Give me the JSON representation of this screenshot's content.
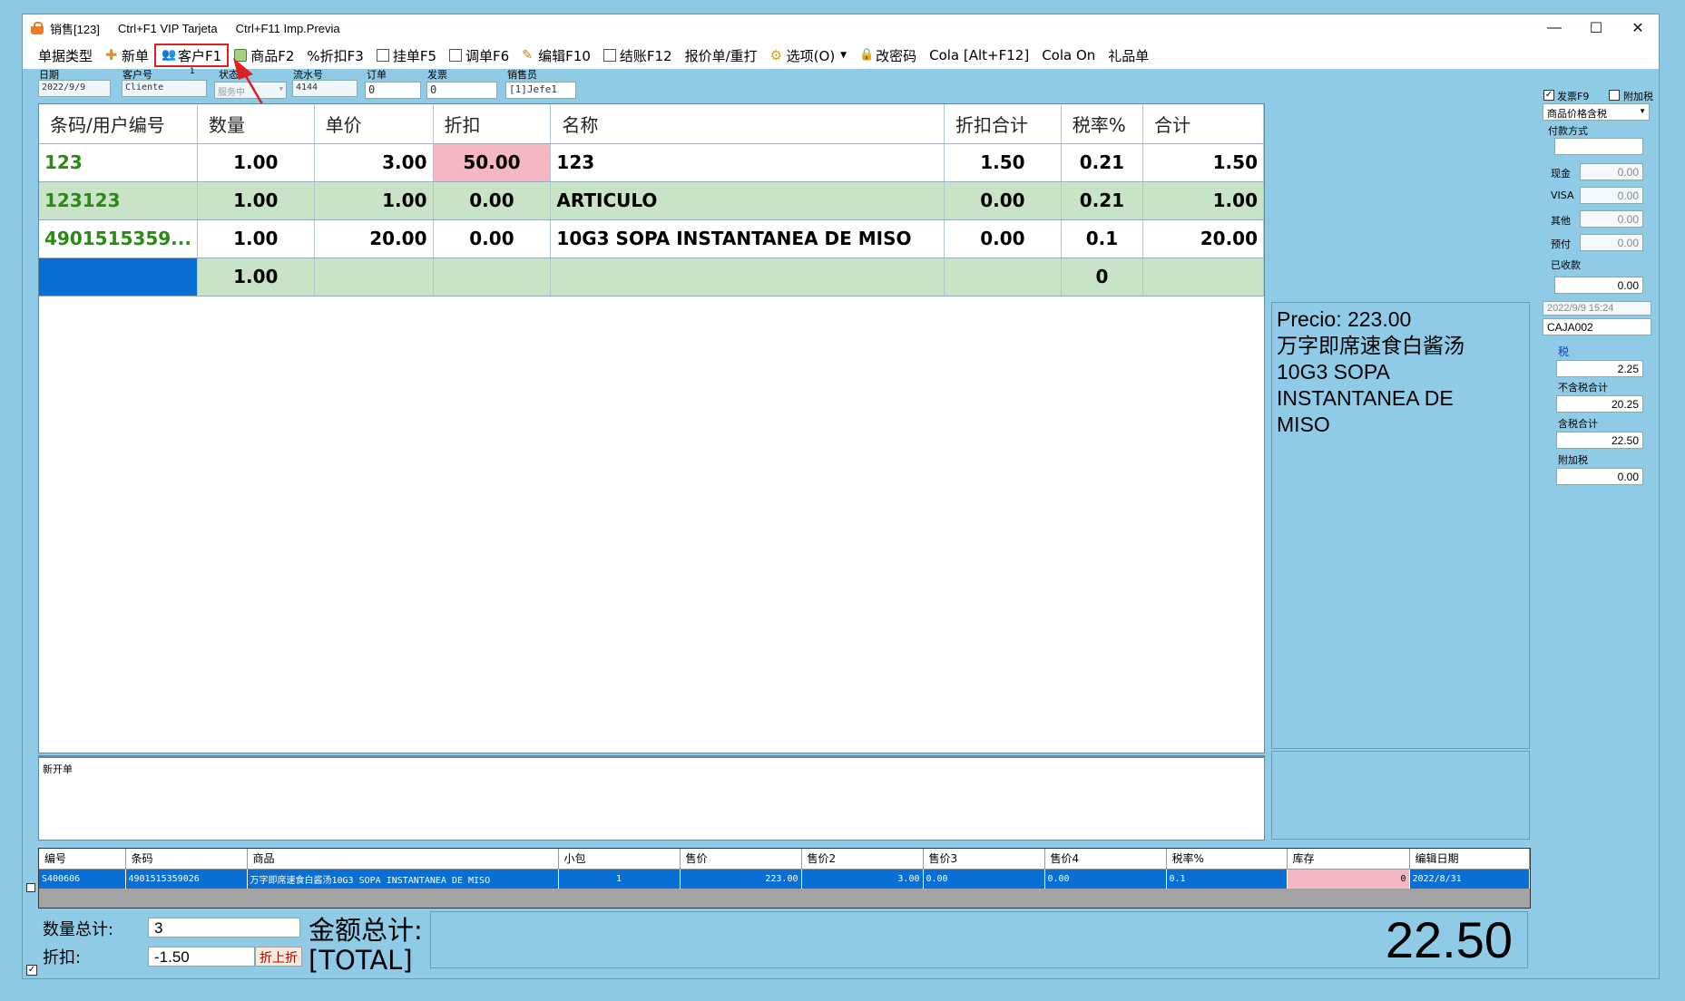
{
  "titlebar": {
    "title": "销售[123]",
    "hint1": "Ctrl+F1 VIP Tarjeta",
    "hint2": "Ctrl+F11 Imp.Previa",
    "min": "—",
    "max": "☐",
    "close": "✕"
  },
  "menu": {
    "doc_type": "单据类型",
    "new": "新单",
    "customer": "客户F1",
    "product": "商品F2",
    "discount": "%折扣F3",
    "hold": "挂单F5",
    "recall": "调单F6",
    "edit": "编辑F10",
    "checkout": "结账F12",
    "quote": "报价单/重打",
    "options": "选项(O)",
    "password": "改密码",
    "cola": "Cola [Alt+F12]",
    "cola_on": "Cola On",
    "gift": "礼品单"
  },
  "header": {
    "date_label": "日期",
    "date_value": "2022/9/9",
    "cust_label": "客户号",
    "cust_value": "Cliente",
    "cust_flag": "1",
    "status_label": "状态",
    "status_value": "服务中",
    "serial_label": "流水号",
    "serial_value": "4144",
    "order_label": "订单",
    "order_value": "0",
    "invoice_label": "发票",
    "invoice_value": "0",
    "seller_label": "销售员",
    "seller_value": "[1]Jefe1"
  },
  "grid": {
    "columns": [
      "条码/用户编号",
      "数量",
      "单价",
      "折扣",
      "名称",
      "折扣合计",
      "税率%",
      "合计"
    ],
    "rows": [
      {
        "code": "123",
        "qty": "1.00",
        "price": "3.00",
        "disc": "50.00",
        "name": "123",
        "disc_total": "1.50",
        "tax": "0.21",
        "total": "1.50"
      },
      {
        "code": "123123",
        "qty": "1.00",
        "price": "1.00",
        "disc": "0.00",
        "name": "ARTICULO",
        "disc_total": "0.00",
        "tax": "0.21",
        "total": "1.00"
      },
      {
        "code": "4901515359...",
        "qty": "1.00",
        "price": "20.00",
        "disc": "0.00",
        "name": "10G3 SOPA INSTANTANEA DE MISO",
        "disc_total": "0.00",
        "tax": "0.1",
        "total": "20.00"
      },
      {
        "code": "",
        "qty": "1.00",
        "price": "",
        "disc": "",
        "name": "",
        "disc_total": "",
        "tax": "0",
        "total": ""
      }
    ]
  },
  "memo": {
    "label": "新开单"
  },
  "info": {
    "precio": "Precio: 223.00",
    "line1": "万字即席速食白酱汤",
    "line2": "10G3 SOPA",
    "line3": "INSTANTANEA DE",
    "line4": "MISO"
  },
  "right": {
    "invoice_cb": "发票F9",
    "addtax_cb": "附加税",
    "price_mode": "商品价格含税",
    "pay_method": "付款方式",
    "cash_label": "现金",
    "cash": "0.00",
    "visa_label": "VISA",
    "visa": "0.00",
    "other_label": "其他",
    "other": "0.00",
    "prepay_label": "预付",
    "prepay": "0.00",
    "received_label": "已收款",
    "received": "0.00",
    "datetime": "2022/9/9 15:24",
    "register": "CAJA002",
    "tax_label": "税",
    "tax": "2.25",
    "pretax_label": "不含税合计",
    "pretax": "20.25",
    "withtax_label": "含税合计",
    "withtax": "22.50",
    "surcharge_label": "附加税",
    "surcharge": "0.00"
  },
  "product_list": {
    "columns": [
      "编号",
      "条码",
      "商品",
      "小包",
      "售价",
      "售价2",
      "售价3",
      "售价4",
      "税率%",
      "库存",
      "编辑日期"
    ],
    "row": [
      "S400606",
      "4901515359026",
      "万字即席速食白酱汤10G3 SOPA INSTANTANEA DE MISO",
      "1",
      "223.00",
      "3.00",
      "0.00",
      "0.00",
      "0.1",
      "0",
      "2022/8/31"
    ]
  },
  "footer": {
    "qty_label": "数量总计:",
    "qty": "3",
    "disc_label": "折扣:",
    "disc": "-1.50",
    "fold_btn": "折上折",
    "amount_label": "金额总计:",
    "total_label": "[TOTAL]",
    "total": "22.50"
  }
}
